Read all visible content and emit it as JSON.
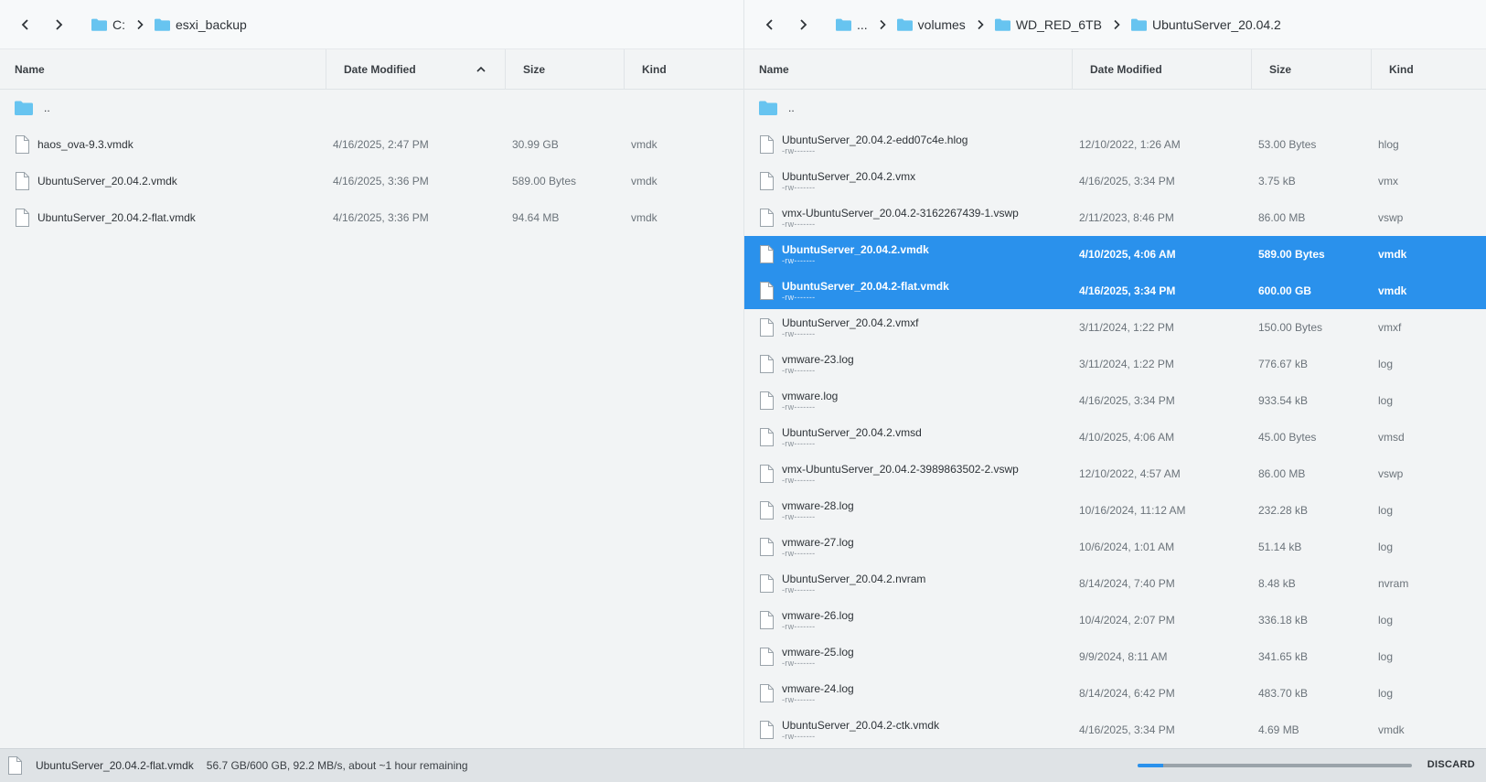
{
  "colors": {
    "accent": "#2a91ec",
    "folder": "#67c4f0"
  },
  "left_pane": {
    "breadcrumbs": [
      "C:",
      "esxi_backup"
    ],
    "columns": {
      "name": "Name",
      "date": "Date Modified",
      "size": "Size",
      "kind": "Kind"
    },
    "parent": "..",
    "files": [
      {
        "name": "haos_ova-9.3.vmdk",
        "date": "4/16/2025, 2:47 PM",
        "size": "30.99 GB",
        "kind": "vmdk"
      },
      {
        "name": "UbuntuServer_20.04.2.vmdk",
        "date": "4/16/2025, 3:36 PM",
        "size": "589.00 Bytes",
        "kind": "vmdk"
      },
      {
        "name": "UbuntuServer_20.04.2-flat.vmdk",
        "date": "4/16/2025, 3:36 PM",
        "size": "94.64 MB",
        "kind": "vmdk"
      }
    ]
  },
  "right_pane": {
    "breadcrumbs": [
      "...",
      "volumes",
      "WD_RED_6TB",
      "UbuntuServer_20.04.2"
    ],
    "columns": {
      "name": "Name",
      "date": "Date Modified",
      "size": "Size",
      "kind": "Kind"
    },
    "parent": "..",
    "files": [
      {
        "name": "UbuntuServer_20.04.2-edd07c4e.hlog",
        "perm": "-rw-------",
        "date": "12/10/2022, 1:26 AM",
        "size": "53.00 Bytes",
        "kind": "hlog",
        "selected": false
      },
      {
        "name": "UbuntuServer_20.04.2.vmx",
        "perm": "-rw-------",
        "date": "4/16/2025, 3:34 PM",
        "size": "3.75 kB",
        "kind": "vmx",
        "selected": false
      },
      {
        "name": "vmx-UbuntuServer_20.04.2-3162267439-1.vswp",
        "perm": "-rw-------",
        "date": "2/11/2023, 8:46 PM",
        "size": "86.00 MB",
        "kind": "vswp",
        "selected": false
      },
      {
        "name": "UbuntuServer_20.04.2.vmdk",
        "perm": "-rw-------",
        "date": "4/10/2025, 4:06 AM",
        "size": "589.00 Bytes",
        "kind": "vmdk",
        "selected": true
      },
      {
        "name": "UbuntuServer_20.04.2-flat.vmdk",
        "perm": "-rw-------",
        "date": "4/16/2025, 3:34 PM",
        "size": "600.00 GB",
        "kind": "vmdk",
        "selected": true
      },
      {
        "name": "UbuntuServer_20.04.2.vmxf",
        "perm": "-rw-------",
        "date": "3/11/2024, 1:22 PM",
        "size": "150.00 Bytes",
        "kind": "vmxf",
        "selected": false
      },
      {
        "name": "vmware-23.log",
        "perm": "-rw-------",
        "date": "3/11/2024, 1:22 PM",
        "size": "776.67 kB",
        "kind": "log",
        "selected": false
      },
      {
        "name": "vmware.log",
        "perm": "-rw-------",
        "date": "4/16/2025, 3:34 PM",
        "size": "933.54 kB",
        "kind": "log",
        "selected": false
      },
      {
        "name": "UbuntuServer_20.04.2.vmsd",
        "perm": "-rw-------",
        "date": "4/10/2025, 4:06 AM",
        "size": "45.00 Bytes",
        "kind": "vmsd",
        "selected": false
      },
      {
        "name": "vmx-UbuntuServer_20.04.2-3989863502-2.vswp",
        "perm": "-rw-------",
        "date": "12/10/2022, 4:57 AM",
        "size": "86.00 MB",
        "kind": "vswp",
        "selected": false
      },
      {
        "name": "vmware-28.log",
        "perm": "-rw-------",
        "date": "10/16/2024, 11:12 AM",
        "size": "232.28 kB",
        "kind": "log",
        "selected": false
      },
      {
        "name": "vmware-27.log",
        "perm": "-rw-------",
        "date": "10/6/2024, 1:01 AM",
        "size": "51.14 kB",
        "kind": "log",
        "selected": false
      },
      {
        "name": "UbuntuServer_20.04.2.nvram",
        "perm": "-rw-------",
        "date": "8/14/2024, 7:40 PM",
        "size": "8.48 kB",
        "kind": "nvram",
        "selected": false
      },
      {
        "name": "vmware-26.log",
        "perm": "-rw-------",
        "date": "10/4/2024, 2:07 PM",
        "size": "336.18 kB",
        "kind": "log",
        "selected": false
      },
      {
        "name": "vmware-25.log",
        "perm": "-rw-------",
        "date": "9/9/2024, 8:11 AM",
        "size": "341.65 kB",
        "kind": "log",
        "selected": false
      },
      {
        "name": "vmware-24.log",
        "perm": "-rw-------",
        "date": "8/14/2024, 6:42 PM",
        "size": "483.70 kB",
        "kind": "log",
        "selected": false
      },
      {
        "name": "UbuntuServer_20.04.2-ctk.vmdk",
        "perm": "-rw-------",
        "date": "4/16/2025, 3:34 PM",
        "size": "4.69 MB",
        "kind": "vmdk",
        "selected": false
      }
    ]
  },
  "status": {
    "file": "UbuntuServer_20.04.2-flat.vmdk",
    "progress_text": "56.7 GB/600 GB, 92.2 MB/s, about ~1 hour remaining",
    "progress_fraction": 0.0945,
    "discard_label": "DISCARD"
  }
}
